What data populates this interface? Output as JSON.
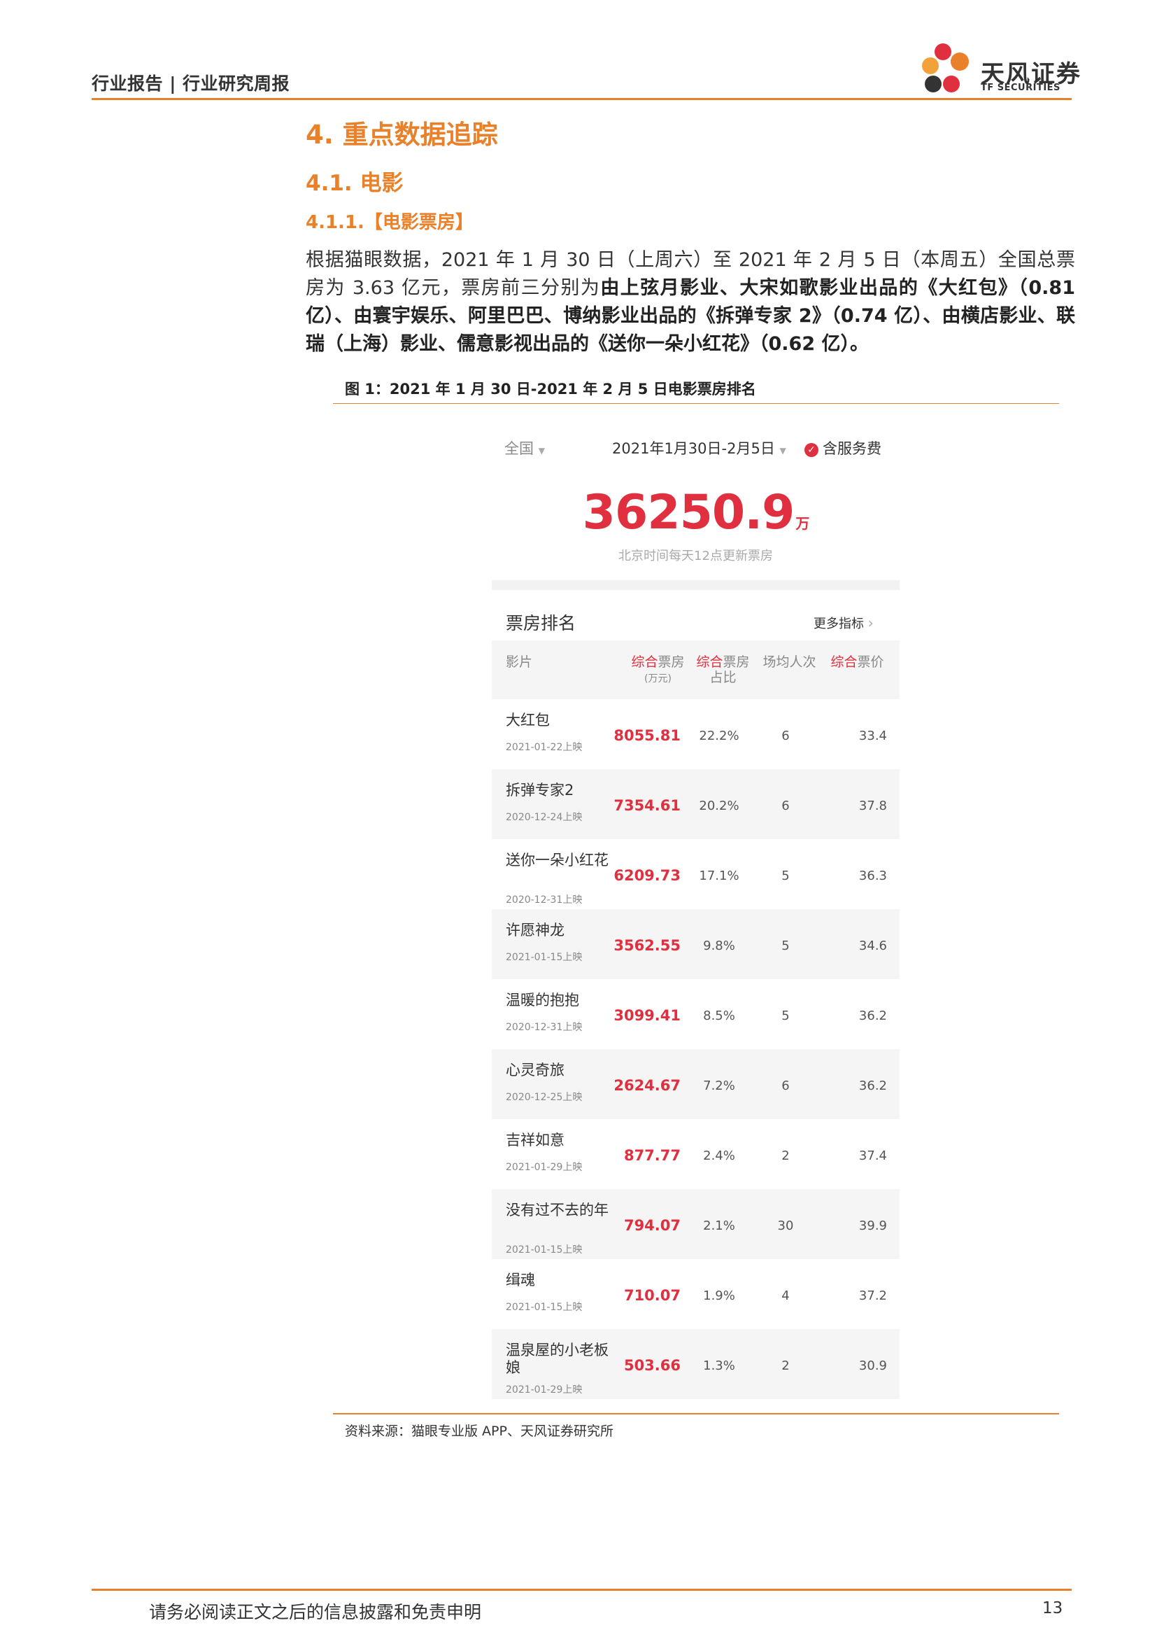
{
  "header": {
    "breadcrumb": "行业报告 | 行业研究周报",
    "logo_name": "天风证券",
    "logo_sub": "TF SECURITIES"
  },
  "headings": {
    "h1": "4. 重点数据追踪",
    "h2": "4.1. 电影",
    "h3": "4.1.1.【电影票房】"
  },
  "paragraph": {
    "part1": "根据猫眼数据，2021 年 1 月 30 日（上周六）至 2021 年 2 月 5 日（本周五）全国总票房为 3.63 亿元，票房前三分别为",
    "part2_bold": "由上弦月影业、大宋如歌影业出品的《大红包》（0.81 亿）、由寰宇娱乐、阿里巴巴、博纳影业出品的《拆弹专家 2》（0.74 亿）、由横店影业、联瑞（上海）影业、儒意影视出品的《送你一朵小红花》（0.62 亿）。"
  },
  "figure": {
    "title": "图 1：2021 年 1 月 30 日-2021 年 2 月 5 日电影票房排名",
    "source": "资料来源：猫眼专业版 APP、天风证券研究所"
  },
  "app": {
    "region": "全国",
    "date_range": "2021年1月30日-2月5日",
    "service_fee": "含服务费",
    "total": "36250.9",
    "total_unit": "万",
    "update_note": "北京时间每天12点更新票房",
    "rank_title": "票房排名",
    "more": "更多指标",
    "columns": {
      "film": "影片",
      "bo_prefix": "综合",
      "bo_suffix": "票房",
      "bo_unit": "(万元)",
      "share_prefix": "综合",
      "share_suffix": "票房",
      "share_line2": "占比",
      "avg": "场均人次",
      "price_prefix": "综合",
      "price_suffix": "票价"
    },
    "rows": [
      {
        "name": "大红包",
        "date": "2021-01-22上映",
        "bo": "8055.81",
        "share": "22.2%",
        "avg": "6",
        "price": "33.4"
      },
      {
        "name": "拆弹专家2",
        "date": "2020-12-24上映",
        "bo": "7354.61",
        "share": "20.2%",
        "avg": "6",
        "price": "37.8"
      },
      {
        "name": "送你一朵小红花",
        "date": "2020-12-31上映",
        "bo": "6209.73",
        "share": "17.1%",
        "avg": "5",
        "price": "36.3"
      },
      {
        "name": "许愿神龙",
        "date": "2021-01-15上映",
        "bo": "3562.55",
        "share": "9.8%",
        "avg": "5",
        "price": "34.6"
      },
      {
        "name": "温暖的抱抱",
        "date": "2020-12-31上映",
        "bo": "3099.41",
        "share": "8.5%",
        "avg": "5",
        "price": "36.2"
      },
      {
        "name": "心灵奇旅",
        "date": "2020-12-25上映",
        "bo": "2624.67",
        "share": "7.2%",
        "avg": "6",
        "price": "36.2"
      },
      {
        "name": "吉祥如意",
        "date": "2021-01-29上映",
        "bo": "877.77",
        "share": "2.4%",
        "avg": "2",
        "price": "37.4"
      },
      {
        "name": "没有过不去的年",
        "date": "2021-01-15上映",
        "bo": "794.07",
        "share": "2.1%",
        "avg": "30",
        "price": "39.9"
      },
      {
        "name": "缉魂",
        "date": "2021-01-15上映",
        "bo": "710.07",
        "share": "1.9%",
        "avg": "4",
        "price": "37.2"
      },
      {
        "name": "温泉屋的小老板娘",
        "date": "2021-01-29上映",
        "bo": "503.66",
        "share": "1.3%",
        "avg": "2",
        "price": "30.9"
      }
    ]
  },
  "footer": {
    "disclaimer": "请务必阅读正文之后的信息披露和免责申明",
    "page": "13"
  },
  "colors": {
    "accent": "#e8812a",
    "app_red": "#e0303f"
  }
}
